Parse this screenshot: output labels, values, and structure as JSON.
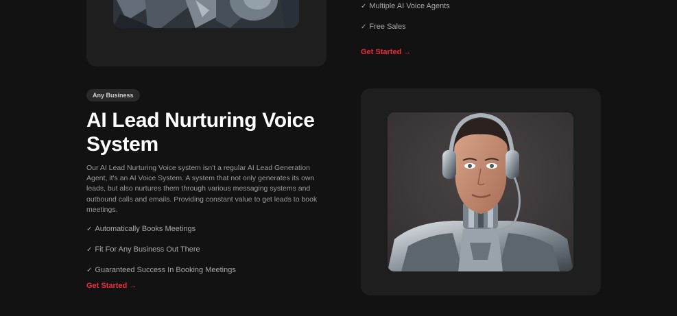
{
  "top_feature": {
    "checklist": [
      "Multiple AI Voice Agents",
      "Free Sales"
    ],
    "cta_label": "Get Started",
    "cta_arrow": "→"
  },
  "section": {
    "badge": "Any Business",
    "title": "AI Lead Nurturing Voice System",
    "description": "Our AI Lead Nurturing Voice system isn't a regular AI Lead Generation Agent, it's an AI Voice System. A system that not only generates its own leads, but also nurtures them through various messaging systems and outbound calls and emails. Providing constant value to get leads to book meetings.",
    "checklist": [
      "Automatically Books Meetings",
      "Fit For Any Business Out There",
      "Guaranteed Success In Booking Meetings"
    ],
    "cta_label": "Get Started",
    "cta_arrow": "→"
  },
  "icons": {
    "check": "check-icon",
    "arrow": "arrow-right-icon"
  },
  "colors": {
    "background": "#121212",
    "card": "#1e1e1e",
    "accent": "#ee2c3c",
    "muted_text": "#9a9a9a"
  }
}
